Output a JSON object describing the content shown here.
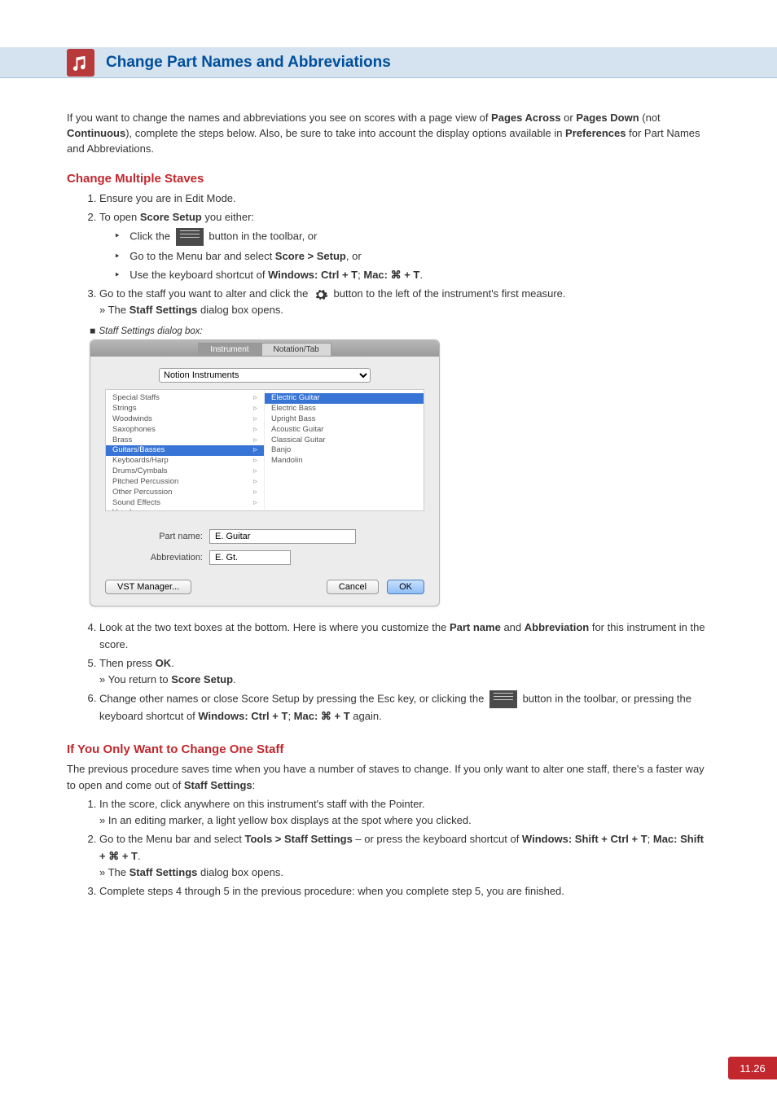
{
  "header": {
    "title": "Change Part Names and Abbreviations"
  },
  "intro": {
    "t1": "If you want to change the names and abbreviations you see on scores with a page view of ",
    "b1": "Pages Across",
    "t2": " or ",
    "b2": "Pages Down",
    "t3": " (not ",
    "b3": "Continuous",
    "t4": "), complete the steps below. Also, be sure to take into account the display options available in ",
    "b4": "Preferences",
    "t5": " for Part Names and Abbreviations."
  },
  "sectionA": {
    "heading": "Change Multiple Staves",
    "step1": "Ensure you are in Edit Mode.",
    "step2_lead": "To open ",
    "step2_bold": "Score Setup",
    "step2_tail": " you either:",
    "sub_a1": "Click the ",
    "sub_a2": " button in the toolbar, or",
    "sub_b1": "Go to the Menu bar and select ",
    "sub_b2": "Score > Setup",
    "sub_b3": ", or",
    "sub_c1": "Use the keyboard shortcut of ",
    "sub_c2": "Windows: Ctrl + T",
    "sub_c3": "; ",
    "sub_c4": "Mac: ⌘ + T",
    "sub_c5": ".",
    "step3a": "Go to the staff you want to alter and click the ",
    "step3b": " button to the left of the instrument's first measure.",
    "step3c1": "» The ",
    "step3c2": "Staff Settings",
    "step3c3": " dialog box opens.",
    "caption": "Staff Settings dialog box:",
    "step4a": "Look at the two text boxes at the bottom. Here is where you customize the ",
    "step4b": "Part name",
    "step4c": " and ",
    "step4d": "Abbreviation",
    "step4e": " for this instrument in the score.",
    "step5a": "Then press ",
    "step5b": "OK",
    "step5c": ".",
    "step5d": "» You return to ",
    "step5e": "Score Setup",
    "step5f": ".",
    "step6a": "Change other names or close Score Setup by pressing the Esc key, or clicking the ",
    "step6b": " button in the toolbar, or pressing the keyboard shortcut of ",
    "step6c": "Windows: Ctrl + T",
    "step6d": "; ",
    "step6e": "Mac: ⌘ + T",
    "step6f": " again."
  },
  "dialog": {
    "tab1": "Instrument",
    "tab2": "Notation/Tab",
    "library": "Notion Instruments",
    "left": [
      "Special Staffs",
      "Strings",
      "Woodwinds",
      "Saxophones",
      "Brass",
      "Guitars/Basses",
      "Keyboards/Harp",
      "Drums/Cymbals",
      "Pitched Percussion",
      "Other Percussion",
      "Sound Effects",
      "Vocal"
    ],
    "left_sel": 5,
    "right": [
      "Electric Guitar",
      "Electric Bass",
      "Upright Bass",
      "Acoustic Guitar",
      "Classical Guitar",
      "Banjo",
      "Mandolin"
    ],
    "right_sel": 0,
    "pn_label": "Part name:",
    "pn_value": "E. Guitar",
    "ab_label": "Abbreviation:",
    "ab_value": "E. Gt.",
    "vst": "VST Manager...",
    "cancel": "Cancel",
    "ok": "OK"
  },
  "sectionB": {
    "heading": "If You Only Want to Change One Staff",
    "p1": "The previous procedure saves time when you have a number of staves to change. If you only want to alter one staff, there's a faster way to open and come out of ",
    "p1b": "Staff Settings",
    "p1c": ":",
    "s1a": "In the score, click anywhere on this instrument's staff with the Pointer.",
    "s1b": "» In an editing marker, a light yellow box displays at the spot where you clicked.",
    "s2a": "Go to the Menu bar and select ",
    "s2b": "Tools > Staff Settings",
    "s2c": " – or press the keyboard shortcut of ",
    "s2d": "Windows: Shift + Ctrl + T",
    "s2e": "; ",
    "s2f": "Mac: Shift + ⌘ + T",
    "s2g": ".",
    "s2h1": "» The ",
    "s2h2": "Staff Settings",
    "s2h3": " dialog box opens.",
    "s3": "Complete steps 4 through 5 in the previous procedure: when you complete step 5, you are finished."
  },
  "pagenum": "11.26"
}
